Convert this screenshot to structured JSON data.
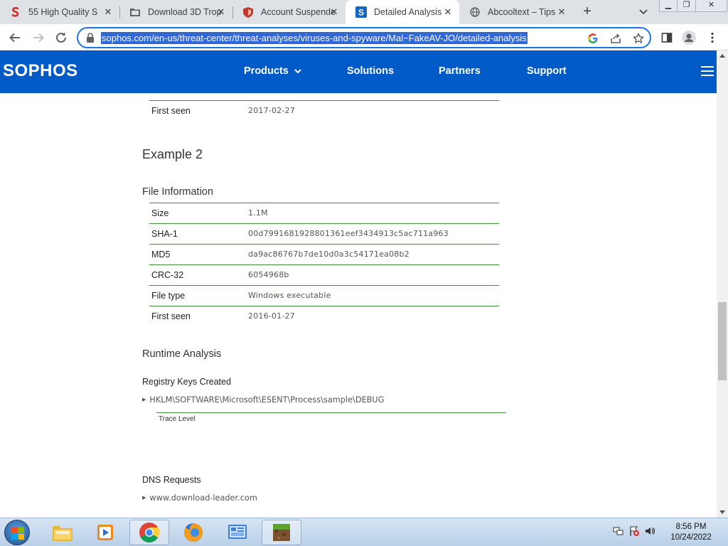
{
  "browser": {
    "tabs": [
      {
        "title": "55 High Quality S",
        "favicon": "sophos-red-s-icon"
      },
      {
        "title": "Download 3D Trop",
        "favicon": "folder-icon"
      },
      {
        "title": "Account Suspende",
        "favicon": "shield-icon"
      },
      {
        "title": "Detailed Analysis",
        "favicon": "sophos-s-icon",
        "active": true
      },
      {
        "title": "Abcooltext – Tips",
        "favicon": "globe-icon"
      }
    ],
    "new_tab_label": "+",
    "url": "sophos.com/en-us/threat-center/threat-analyses/viruses-and-spyware/Mal~FakeAV-JO/detailed-analysis"
  },
  "site": {
    "logo": "SOPHOS",
    "nav": {
      "products": "Products",
      "solutions": "Solutions",
      "partners": "Partners",
      "support": "Support"
    },
    "brand_color": "#005bc8"
  },
  "content": {
    "prev_row": {
      "key": "First seen",
      "value": "2017-02-27"
    },
    "example_heading": "Example 2",
    "file_info_heading": "File Information",
    "file_info": [
      {
        "key": "Size",
        "value": "1.1M"
      },
      {
        "key": "SHA-1",
        "value": "00d7991681928801361eef3434913c5ac711a963"
      },
      {
        "key": "MD5",
        "value": "da9ac86767b7de10d0a3c54171ea08b2"
      },
      {
        "key": "CRC-32",
        "value": "6054968b"
      },
      {
        "key": "File type",
        "value": "Windows executable"
      },
      {
        "key": "First seen",
        "value": "2016-01-27"
      }
    ],
    "runtime_heading": "Runtime Analysis",
    "registry_heading": "Registry Keys Created",
    "registry_key": "HKLM\\SOFTWARE\\Microsoft\\ESENT\\Process\\sample\\DEBUG",
    "registry_sub": "Trace Level",
    "dns_heading": "DNS Requests",
    "dns_entry": "www.download-leader.com"
  },
  "taskbar": {
    "time": "8:56 PM",
    "date": "10/24/2022"
  }
}
